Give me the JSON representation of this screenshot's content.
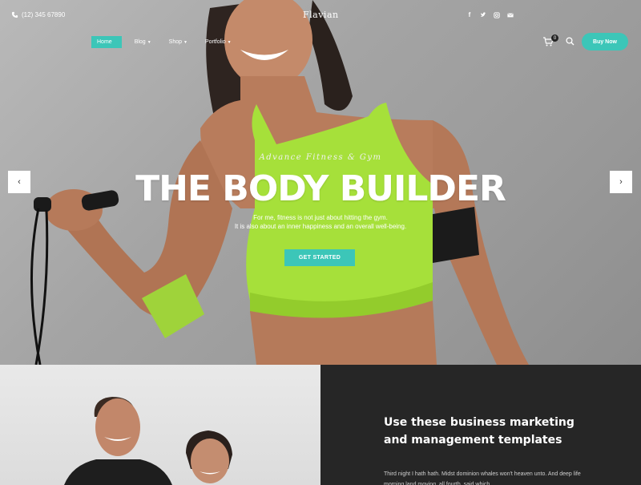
{
  "topbar": {
    "phone": "(12) 345 67890",
    "logo": "Flavian",
    "socials": [
      "facebook-icon",
      "twitter-icon",
      "instagram-icon",
      "email-icon"
    ]
  },
  "nav": {
    "items": [
      {
        "label": "Home",
        "active": true
      },
      {
        "label": "Blog",
        "has_dropdown": true
      },
      {
        "label": "Shop",
        "has_dropdown": true
      },
      {
        "label": "Portfolio",
        "has_dropdown": true
      }
    ],
    "cart_count": "0",
    "buy_label": "Buy Now"
  },
  "hero": {
    "kicker": "Advance Fitness & Gym",
    "title": "THE BODY BUILDER",
    "line1": "For me, fitness is not just about hitting the gym.",
    "line2": "It is also about an inner happiness and an overall well-being.",
    "cta": "GET STARTED",
    "prev_icon": "‹",
    "next_icon": "›"
  },
  "feature": {
    "heading_line1": "Use these business marketing",
    "heading_line2": "and management templates",
    "text": "Third night I hath hath. Midst dominion whales won't heaven unto. And deep life morning land moving, all fourth, said which"
  },
  "colors": {
    "accent": "#3cc6b8",
    "dark_panel": "#262626"
  }
}
